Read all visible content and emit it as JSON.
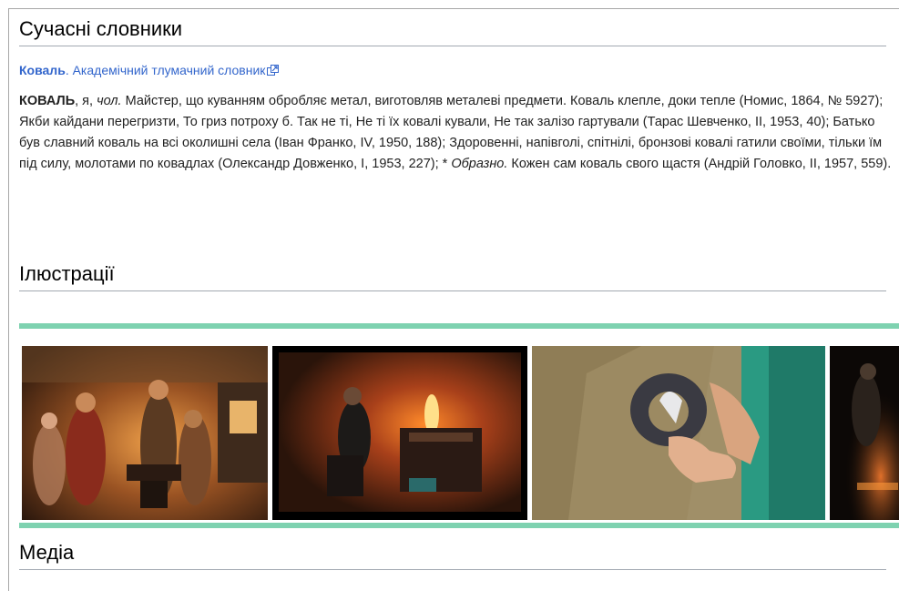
{
  "sections": {
    "modern_dictionaries": "Сучасні словники",
    "illustrations": "Ілюстрації",
    "media": "Медіа"
  },
  "source": {
    "headword": "Коваль",
    "separator": ". ",
    "dictionary_link": "Академічний тлумачний словник",
    "icon": "external-link-icon"
  },
  "entry": {
    "headword": "КОВАЛЬ",
    "grammar": ", я, ",
    "pos": "чол.",
    "text": " Майстер, що куванням обробляє метал, виготовляв металеві предмети. Коваль клепле, доки тепле (Номис, 1864, № 5927); Якби кайдани перегризти, То гриз потроху б. Так не ті, Не ті їх ковалі кували, Не так залізо гартували (Тарас Шевченко, II, 1953, 40); Батько був славний коваль на всі околишні села (Іван Франко, IV, 1950, 188); Здоровенні, напівголі, спітнілі, бронзові ковалі гатили своїми, тільки їм під силу, молотами по ковадлах (Олександр Довженко, I, 1953, 227); * ",
    "figurative": "Образно.",
    "example": " Кожен сам коваль свого щастя (Андрій Головко, II, 1957, 559)."
  },
  "gallery": {
    "accent_color": "#7ed2b0",
    "images": [
      "blacksmiths-painting",
      "blacksmith-at-forge-photo",
      "horseshoe-photo",
      "blacksmith-dark-photo"
    ]
  }
}
